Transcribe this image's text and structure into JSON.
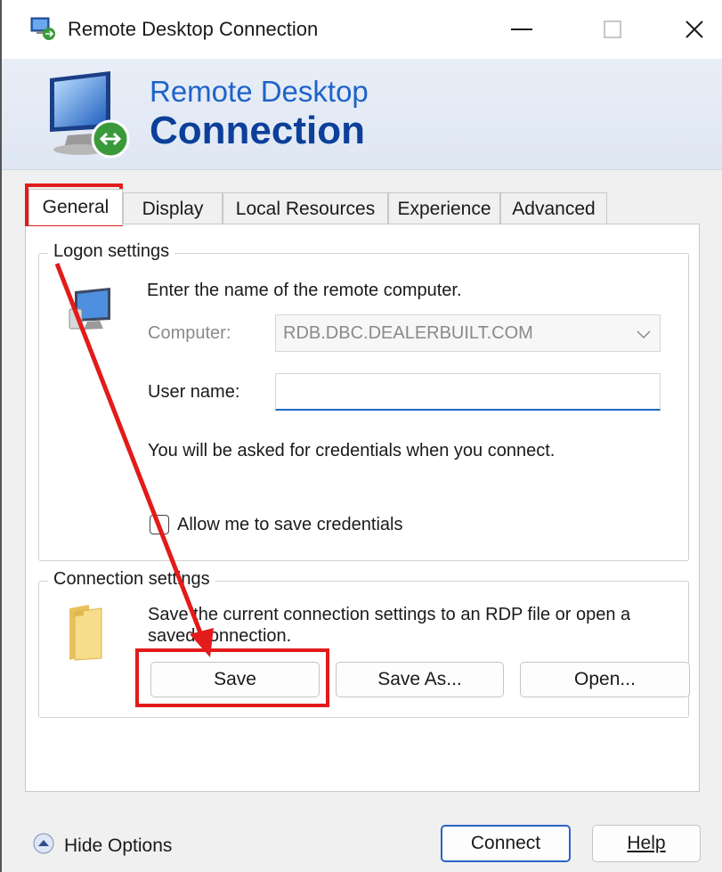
{
  "window": {
    "title": "Remote Desktop Connection",
    "minimize_glyph": "—",
    "close_glyph": "✕"
  },
  "banner": {
    "line1": "Remote Desktop",
    "line2": "Connection"
  },
  "tabs": [
    {
      "label": "General",
      "active": true
    },
    {
      "label": "Display",
      "active": false
    },
    {
      "label": "Local Resources",
      "active": false
    },
    {
      "label": "Experience",
      "active": false
    },
    {
      "label": "Advanced",
      "active": false
    }
  ],
  "logon": {
    "legend": "Logon settings",
    "instruction": "Enter the name of the remote computer.",
    "computer_label": "Computer:",
    "computer_value": "RDB.DBC.DEALERBUILT.COM",
    "username_label": "User name:",
    "username_value": "",
    "credentials_note": "You will be asked for credentials when you connect.",
    "allow_save_label": "Allow me to save credentials",
    "allow_save_checked": false
  },
  "connection": {
    "legend": "Connection settings",
    "description_line1": "Save the current connection settings to an RDP file or open a",
    "description_line2": "saved connection.",
    "save_label": "Save",
    "save_as_label": "Save As...",
    "open_label": "Open..."
  },
  "footer": {
    "hide_options_label": "Hide Options",
    "connect_label": "Connect",
    "help_label": "Help"
  },
  "colors": {
    "annotation_red": "#e21b1b",
    "banner_title_blue": "#1e63c9",
    "banner_bold_blue": "#0b3f9a",
    "input_focus_blue": "#2067c6"
  },
  "icons": [
    "rdc-app-icon",
    "monitor-connect-icon",
    "computer-icon",
    "folder-icon",
    "chevron-down-icon",
    "chevron-up-circle-icon"
  ]
}
